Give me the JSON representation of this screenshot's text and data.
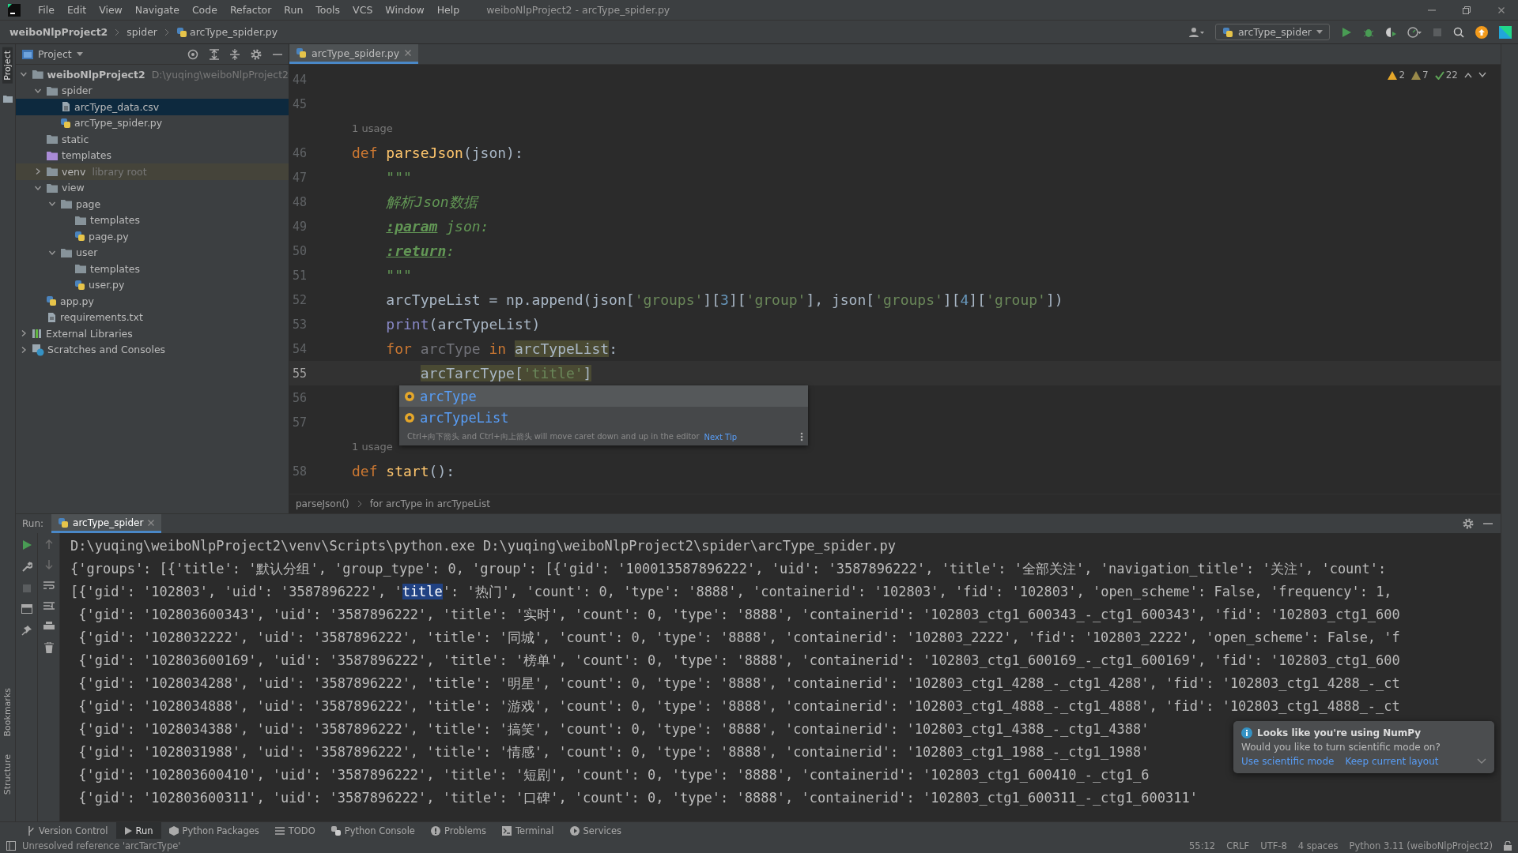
{
  "menu_bar": {
    "menus": [
      "File",
      "Edit",
      "View",
      "Navigate",
      "Code",
      "Refactor",
      "Run",
      "Tools",
      "VCS",
      "Window",
      "Help"
    ],
    "title": "weiboNlpProject2 - arcType_spider.py"
  },
  "nav_bar": {
    "breadcrumbs": [
      "weiboNlpProject2",
      "spider",
      "arcType_spider.py"
    ],
    "run_config": "arcType_spider"
  },
  "side_strip": {
    "top": [
      "Project"
    ],
    "bottom": [
      "Bookmarks",
      "Structure"
    ]
  },
  "project": {
    "title": "Project",
    "tree": [
      {
        "label": "weiboNlpProject2",
        "note": "D:\\yuqing\\weiboNlpProject2",
        "kind": "folder",
        "expanded": true,
        "selected": false,
        "children": [
          {
            "label": "spider",
            "kind": "folder",
            "expanded": true,
            "selected": false,
            "children": [
              {
                "label": "arcType_data.csv",
                "kind": "csv",
                "selected": true
              },
              {
                "label": "arcType_spider.py",
                "kind": "python",
                "selected": false
              }
            ]
          },
          {
            "label": "static",
            "kind": "folder",
            "selected": false
          },
          {
            "label": "templates",
            "kind": "template-folder",
            "selected": false
          },
          {
            "label": "venv",
            "note": "library root",
            "kind": "library-folder",
            "expanded": false,
            "selected": false
          },
          {
            "label": "view",
            "kind": "folder",
            "expanded": true,
            "selected": false,
            "children": [
              {
                "label": "page",
                "kind": "folder",
                "expanded": true,
                "selected": false,
                "children": [
                  {
                    "label": "templates",
                    "kind": "folder",
                    "selected": false
                  },
                  {
                    "label": "page.py",
                    "kind": "python",
                    "selected": false
                  }
                ]
              },
              {
                "label": "user",
                "kind": "folder",
                "expanded": true,
                "selected": false,
                "children": [
                  {
                    "label": "templates",
                    "kind": "folder",
                    "selected": false
                  },
                  {
                    "label": "user.py",
                    "kind": "python",
                    "selected": false
                  }
                ]
              }
            ]
          },
          {
            "label": "app.py",
            "kind": "python",
            "selected": false
          },
          {
            "label": "requirements.txt",
            "kind": "text",
            "selected": false
          }
        ]
      },
      {
        "label": "External Libraries",
        "kind": "libraries",
        "expanded": false,
        "selected": false
      },
      {
        "label": "Scratches and Consoles",
        "kind": "scratches",
        "expanded": false,
        "selected": false
      }
    ]
  },
  "editor": {
    "tabs": [
      {
        "label": "arcType_spider.py",
        "selected": true
      }
    ],
    "inspections": [
      {
        "kind": "warning",
        "count": "2"
      },
      {
        "kind": "weak-warning",
        "count": "7"
      },
      {
        "kind": "typo",
        "count": "22"
      }
    ],
    "lines": [
      {
        "kind": "code",
        "number": "44",
        "current": false
      },
      {
        "kind": "code",
        "number": "45",
        "current": false
      },
      {
        "kind": "hint",
        "text": "1 usage"
      },
      {
        "kind": "code",
        "number": "46",
        "current": false,
        "tokens": [
          {
            "text": "def",
            "kind": "kw"
          },
          {
            "text": " parseJson",
            "kind": "func"
          },
          {
            "text": "(json):",
            "kind": "plain"
          }
        ]
      },
      {
        "kind": "code",
        "number": "47",
        "current": false,
        "tokens": [
          {
            "text": "    \"\"\"",
            "kind": "doc"
          }
        ]
      },
      {
        "kind": "code",
        "number": "48",
        "current": false,
        "tokens": [
          {
            "text": "    解析Json数据",
            "kind": "doc"
          }
        ]
      },
      {
        "kind": "code",
        "number": "49",
        "current": false,
        "tokens": [
          {
            "text": "    :param",
            "kind": "doctag"
          },
          {
            "text": " json:",
            "kind": "doc"
          }
        ]
      },
      {
        "kind": "code",
        "number": "50",
        "current": false,
        "tokens": [
          {
            "text": "    :return",
            "kind": "doctag"
          },
          {
            "text": ":",
            "kind": "doc"
          }
        ]
      },
      {
        "kind": "code",
        "number": "51",
        "current": false,
        "tokens": [
          {
            "text": "    \"\"\"",
            "kind": "doc"
          }
        ]
      },
      {
        "kind": "code",
        "number": "52",
        "current": false,
        "tokens": [
          {
            "text": "    arcTypeList = np.append(json[",
            "kind": "plain"
          },
          {
            "text": "'groups'",
            "kind": "str"
          },
          {
            "text": "][",
            "kind": "plain"
          },
          {
            "text": "3",
            "kind": "num"
          },
          {
            "text": "][",
            "kind": "plain"
          },
          {
            "text": "'group'",
            "kind": "str"
          },
          {
            "text": "], json[",
            "kind": "plain"
          },
          {
            "text": "'groups'",
            "kind": "str"
          },
          {
            "text": "][",
            "kind": "plain"
          },
          {
            "text": "4",
            "kind": "num"
          },
          {
            "text": "][",
            "kind": "plain"
          },
          {
            "text": "'group'",
            "kind": "str"
          },
          {
            "text": "])",
            "kind": "plain"
          }
        ]
      },
      {
        "kind": "code",
        "number": "53",
        "current": false,
        "tokens": [
          {
            "text": "    print",
            "kind": "builtin"
          },
          {
            "text": "(arcTypeList)",
            "kind": "plain"
          }
        ]
      },
      {
        "kind": "code",
        "number": "54",
        "current": false,
        "tokens": [
          {
            "text": "    for",
            "kind": "kw"
          },
          {
            "text": " arcType ",
            "kind": "dim"
          },
          {
            "text": "in",
            "kind": "kw"
          },
          {
            "text": " arcTypeList",
            "kind": "match"
          },
          {
            "text": ":",
            "kind": "plain"
          }
        ]
      },
      {
        "kind": "code",
        "number": "55",
        "current": true,
        "tokens": [
          {
            "text": "        arcTarcType[",
            "kind": "match"
          },
          {
            "text": "'title'",
            "kind": "matchstr"
          },
          {
            "text": "]",
            "kind": "match"
          }
        ]
      },
      {
        "kind": "code",
        "number": "56",
        "current": false
      },
      {
        "kind": "code",
        "number": "57",
        "current": false
      },
      {
        "kind": "hint",
        "text": "1 usage"
      },
      {
        "kind": "code",
        "number": "58",
        "current": false,
        "tokens": [
          {
            "text": "def",
            "kind": "kw"
          },
          {
            "text": " start",
            "kind": "func"
          },
          {
            "text": "():",
            "kind": "plain"
          }
        ]
      }
    ],
    "completion": {
      "items": [
        {
          "label": "arcType",
          "selected": true
        },
        {
          "label": "arcTypeList",
          "selected": false
        }
      ],
      "tip": "Ctrl+向下箭头 and Ctrl+向上箭头 will move caret down and up in the editor",
      "tip_link": "Next Tip"
    },
    "breadcrumbs": [
      "parseJson()",
      "for arcType in arcTypeList"
    ]
  },
  "run": {
    "label": "Run:",
    "tabs": [
      {
        "label": "arcType_spider",
        "selected": true
      }
    ],
    "output": [
      {
        "parts": [
          {
            "text": "D:\\yuqing\\weiboNlpProject2\\venv\\Scripts\\python.exe D:\\yuqing\\weiboNlpProject2\\spider\\arcType_spider.py",
            "selected": false
          }
        ]
      },
      {
        "parts": [
          {
            "text": "{'groups': [{'title': '默认分组', 'group_type': 0, 'group': [{'gid': '100013587896222', 'uid': '3587896222', 'title': '全部关注', 'navigation_title': '关注', 'count':",
            "selected": false
          }
        ]
      },
      {
        "parts": [
          {
            "text": "[{'gid': '102803', 'uid': '3587896222', '",
            "selected": false
          },
          {
            "text": "title",
            "selected": true
          },
          {
            "text": "': '热门', 'count': 0, 'type': '8888', 'containerid': '102803', 'fid': '102803', 'open_scheme': False, 'frequency': 1,",
            "selected": false
          }
        ]
      },
      {
        "parts": [
          {
            "text": " {'gid': '102803600343', 'uid': '3587896222', 'title': '实时', 'count': 0, 'type': '8888', 'containerid': '102803_ctg1_600343_-_ctg1_600343', 'fid': '102803_ctg1_600",
            "selected": false
          }
        ]
      },
      {
        "parts": [
          {
            "text": " {'gid': '1028032222', 'uid': '3587896222', 'title': '同城', 'count': 0, 'type': '8888', 'containerid': '102803_2222', 'fid': '102803_2222', 'open_scheme': False, 'f",
            "selected": false
          }
        ]
      },
      {
        "parts": [
          {
            "text": " {'gid': '102803600169', 'uid': '3587896222', 'title': '榜单', 'count': 0, 'type': '8888', 'containerid': '102803_ctg1_600169_-_ctg1_600169', 'fid': '102803_ctg1_600",
            "selected": false
          }
        ]
      },
      {
        "parts": [
          {
            "text": " {'gid': '1028034288', 'uid': '3587896222', 'title': '明星', 'count': 0, 'type': '8888', 'containerid': '102803_ctg1_4288_-_ctg1_4288', 'fid': '102803_ctg1_4288_-_ct",
            "selected": false
          }
        ]
      },
      {
        "parts": [
          {
            "text": " {'gid': '1028034888', 'uid': '3587896222', 'title': '游戏', 'count': 0, 'type': '8888', 'containerid': '102803_ctg1_4888_-_ctg1_4888', 'fid': '102803_ctg1_4888_-_ct",
            "selected": false
          }
        ]
      },
      {
        "parts": [
          {
            "text": " {'gid': '1028034388', 'uid': '3587896222', 'title': '搞笑', 'count': 0, 'type': '8888', 'containerid': '102803_ctg1_4388_-_ctg1_4388'",
            "selected": false
          }
        ]
      },
      {
        "parts": [
          {
            "text": " {'gid': '1028031988', 'uid': '3587896222', 'title': '情感', 'count': 0, 'type': '8888', 'containerid': '102803_ctg1_1988_-_ctg1_1988'",
            "selected": false
          }
        ]
      },
      {
        "parts": [
          {
            "text": " {'gid': '102803600410', 'uid': '3587896222', 'title': '短剧', 'count': 0, 'type': '8888', 'containerid': '102803_ctg1_600410_-_ctg1_6",
            "selected": false
          }
        ]
      },
      {
        "parts": [
          {
            "text": " {'gid': '102803600311', 'uid': '3587896222', 'title': '口碑', 'count': 0, 'type': '8888', 'containerid': '102803_ctg1_600311_-_ctg1_600311'",
            "selected": false
          }
        ]
      }
    ],
    "notification": {
      "title": "Looks like you're using NumPy",
      "body": "Would you like to turn scientific mode on?",
      "actions": [
        "Use scientific mode",
        "Keep current layout"
      ]
    }
  },
  "tool_tabs": [
    {
      "label": "Version Control",
      "kind": "vcs",
      "selected": false
    },
    {
      "label": "Run",
      "kind": "run",
      "selected": true
    },
    {
      "label": "Python Packages",
      "kind": "packages",
      "selected": false
    },
    {
      "label": "TODO",
      "kind": "todo",
      "selected": false
    },
    {
      "label": "Python Console",
      "kind": "console",
      "selected": false
    },
    {
      "label": "Problems",
      "kind": "problems",
      "selected": false
    },
    {
      "label": "Terminal",
      "kind": "terminal",
      "selected": false
    },
    {
      "label": "Services",
      "kind": "services",
      "selected": false
    }
  ],
  "status_bar": {
    "message": "Unresolved reference 'arcTarcType'",
    "items": [
      "55:12",
      "CRLF",
      "UTF-8",
      "4 spaces",
      "Python 3.11 (weiboNlpProject2)"
    ]
  }
}
